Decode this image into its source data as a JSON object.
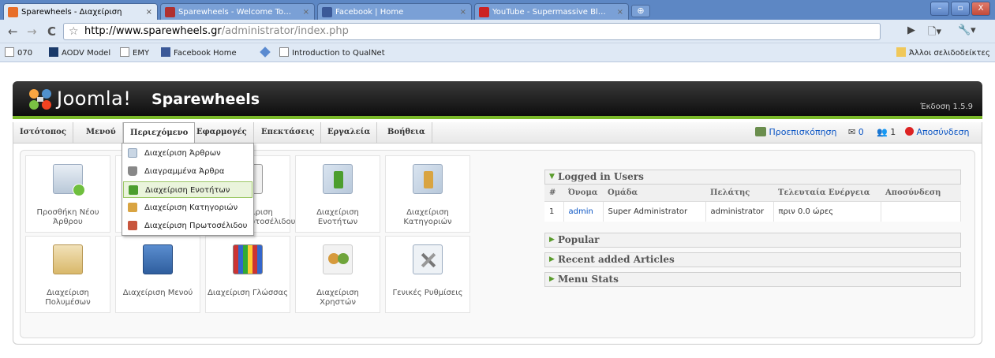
{
  "browser": {
    "tabs": [
      {
        "title": "Sparewheels - Διαχείριση",
        "close": "×",
        "favicon_color": "#e86f2a"
      },
      {
        "title": "Sparewheels - Welcome To…",
        "close": "×",
        "favicon_color": "#b03030"
      },
      {
        "title": "Facebook | Home",
        "close": "×",
        "favicon_color": "#3b5998"
      },
      {
        "title": "YouTube - Supermassive Bl…",
        "close": "×",
        "favicon_color": "#cc2222"
      }
    ],
    "new_tab": "⊕",
    "window_buttons": {
      "minimize": "–",
      "maximize": "▫",
      "close": "X"
    },
    "address": {
      "host": "http://www.sparewheels.gr",
      "path": "/administrator/index.php"
    },
    "nav": {
      "back": "←",
      "forward": "→",
      "reload": "C",
      "star": "☆"
    },
    "toolbar_icons": {
      "play": "▶",
      "page": "🗋▾",
      "wrench": "🔧▾"
    },
    "bookmarks": [
      "070",
      "AODV Model",
      "EMY",
      "Facebook Home",
      "Introduction to QualNet"
    ],
    "other_bookmarks": "Άλλοι σελιδοδείκτες"
  },
  "joomla": {
    "logo_text": "Joomla!",
    "site_name": "Sparewheels",
    "version": "Έκδοση 1.5.9",
    "menu": [
      "Ιστότοπος",
      "Μενού",
      "Περιεχόμενο",
      "Εφαρμογές",
      "Επεκτάσεις",
      "Εργαλεία",
      "Βοήθεια"
    ],
    "status": {
      "preview": "Προεπισκόπηση",
      "messages": "0",
      "users": "1",
      "logout": "Αποσύνδεση"
    },
    "dropdown": [
      "Διαχείριση Άρθρων",
      "Διαγραμμένα Άρθρα",
      "Διαχείριση Ενοτήτων",
      "Διαχείριση Κατηγοριών",
      "Διαχείριση Πρωτοσέλιδου"
    ],
    "cpanel": {
      "add_article": "Προσθήκη Νέου Άρθρου",
      "frontpage": "Διαχείριση Πρωτοσέλιδου",
      "frontpage_partial": "ιριση",
      "sections": "Διαχείριση Ενοτήτων",
      "categories": "Διαχείριση Κατηγοριών",
      "media": "Διαχείριση Πολυμέσων",
      "menus": "Διαχείριση Μενού",
      "language": "Διαχείριση Γλώσσας",
      "users": "Διαχείριση Χρηστών",
      "config": "Γενικές Ρυθμίσεις"
    },
    "panels": {
      "logged_in": "Logged in Users",
      "popular": "Popular",
      "recent": "Recent added Articles",
      "menu_stats": "Menu Stats"
    },
    "users_table": {
      "headers": [
        "#",
        "Όνομα",
        "Ομάδα",
        "Πελάτης",
        "Τελευταία Ενέργεια",
        "Αποσύνδεση"
      ],
      "rows": [
        {
          "num": "1",
          "name": "admin",
          "group": "Super Administrator",
          "client": "administrator",
          "last": "πριν 0.0 ώρες",
          "logout": ""
        }
      ]
    }
  }
}
